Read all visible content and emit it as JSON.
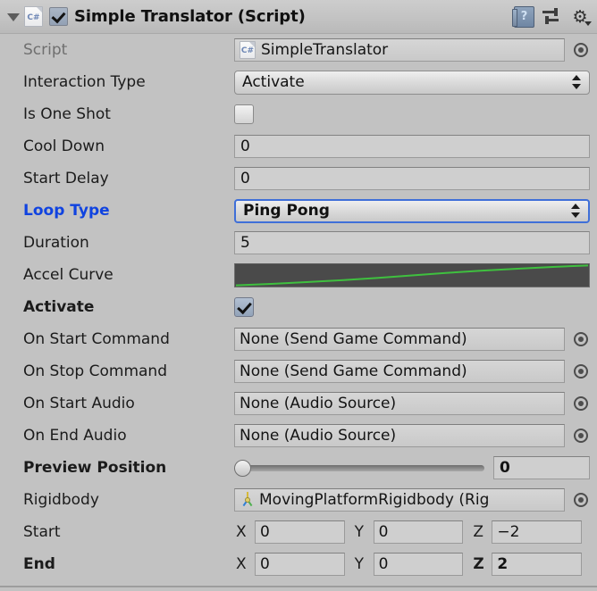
{
  "header": {
    "title": "Simple Translator (Script)",
    "enabled_checkbox": true,
    "script_icon_label": "C#",
    "help_icon": "help-book-icon",
    "preset_icon": "preset-sliders-icon",
    "gear_icon": "gear-icon",
    "gear_glyph": "⚙"
  },
  "rows": {
    "script": {
      "label": "Script",
      "value": "SimpleTranslator",
      "icon_label": "C#",
      "disabled": true
    },
    "interaction_type": {
      "label": "Interaction Type",
      "value": "Activate"
    },
    "is_one_shot": {
      "label": "Is One Shot",
      "checked": false
    },
    "cool_down": {
      "label": "Cool Down",
      "value": "0"
    },
    "start_delay": {
      "label": "Start Delay",
      "value": "0"
    },
    "loop_type": {
      "label": "Loop Type",
      "value": "Ping Pong",
      "modified": true
    },
    "duration": {
      "label": "Duration",
      "value": "5"
    },
    "accel_curve": {
      "label": "Accel Curve"
    },
    "activate": {
      "label": "Activate",
      "checked": true,
      "modified": true
    },
    "on_start_command": {
      "label": "On Start Command",
      "value": "None (Send Game Command)"
    },
    "on_stop_command": {
      "label": "On Stop Command",
      "value": "None (Send Game Command)"
    },
    "on_start_audio": {
      "label": "On Start Audio",
      "value": "None (Audio Source)"
    },
    "on_end_audio": {
      "label": "On End Audio",
      "value": "None (Audio Source)"
    },
    "preview_position": {
      "label": "Preview Position",
      "value": "0",
      "slider_percent": 0,
      "modified": true
    },
    "rigidbody": {
      "label": "Rigidbody",
      "value": "MovingPlatformRigidbody (Rig"
    },
    "start": {
      "label": "Start",
      "axis_x": "X",
      "x": "0",
      "axis_y": "Y",
      "y": "0",
      "axis_z": "Z",
      "z": "−2"
    },
    "end": {
      "label": "End",
      "axis_x": "X",
      "x": "0",
      "axis_y": "Y",
      "y": "0",
      "axis_z": "Z",
      "z": "2",
      "modified": true
    }
  },
  "chart_data": {
    "type": "line",
    "title": "Accel Curve",
    "x": [
      0,
      0.1,
      0.2,
      0.3,
      0.4,
      0.5,
      0.6,
      0.7,
      0.8,
      0.9,
      1.0
    ],
    "values": [
      0.0,
      0.07,
      0.16,
      0.26,
      0.37,
      0.5,
      0.63,
      0.74,
      0.84,
      0.93,
      1.0
    ],
    "xlabel": "",
    "ylabel": "",
    "xlim": [
      0,
      1
    ],
    "ylim": [
      0,
      1
    ],
    "grid": false,
    "line_color": "#3fc03f",
    "background_color": "#4a4a4a"
  },
  "colors": {
    "panel_background": "#c2c2c2",
    "field_background": "#cfcfcf",
    "modified_label": "#1043e0",
    "modified_border": "#3f6fd8",
    "curve_line": "#3fc03f",
    "curve_bg": "#4a4a4a"
  }
}
